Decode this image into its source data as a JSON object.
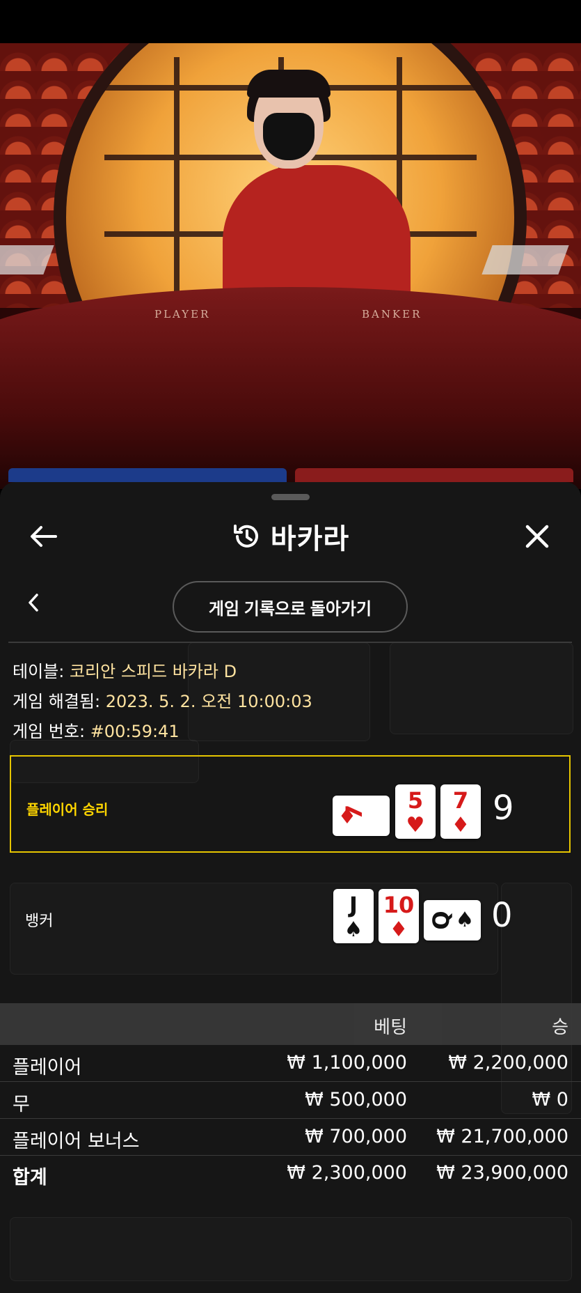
{
  "video": {
    "felt_player": "PLAYER",
    "felt_banker": "BANKER"
  },
  "header": {
    "title": "바카라",
    "history_icon": "history-icon",
    "back_icon": "arrow-left-icon",
    "close_icon": "close-icon"
  },
  "nav": {
    "back_to_history": "게임 기록으로 돌아가기"
  },
  "game_info": {
    "table_label": "테이블:",
    "table_value": "코리안 스피드 바카라 D",
    "resolved_label": "게임 해결됨:",
    "resolved_value": "2023. 5. 2. 오전 10:00:03",
    "number_label": "게임 번호:",
    "number_value": "#00:59:41"
  },
  "hands": {
    "player": {
      "label": "플레이어 승리",
      "score": "9",
      "cards": [
        {
          "rank": "7",
          "suit": "♦",
          "color": "red",
          "sideways": true
        },
        {
          "rank": "5",
          "suit": "♥",
          "color": "red",
          "sideways": false
        },
        {
          "rank": "7",
          "suit": "♦",
          "color": "red",
          "sideways": false
        }
      ]
    },
    "banker": {
      "label": "뱅커",
      "score": "0",
      "cards": [
        {
          "rank": "J",
          "suit": "♠",
          "color": "black",
          "sideways": false
        },
        {
          "rank": "10",
          "suit": "♦",
          "color": "red",
          "sideways": false
        },
        {
          "rank": "Q",
          "suit": "♠",
          "color": "black",
          "sideways": true
        }
      ]
    }
  },
  "bets_table": {
    "headers": {
      "bet": "베팅",
      "win": "승"
    },
    "rows": [
      {
        "name": "플레이어",
        "bet": "₩ 1,100,000",
        "win": "₩ 2,200,000"
      },
      {
        "name": "무",
        "bet": "₩ 500,000",
        "win": "₩ 0"
      },
      {
        "name": "플레이어 보너스",
        "bet": "₩ 700,000",
        "win": "₩ 21,700,000"
      }
    ],
    "total": {
      "name": "합계",
      "bet": "₩ 2,300,000",
      "win": "₩ 23,900,000"
    }
  },
  "colors": {
    "win_border": "#e6c500",
    "win_label": "#ffd600",
    "sheet_bg": "#161616",
    "card_red": "#d61a1a"
  }
}
